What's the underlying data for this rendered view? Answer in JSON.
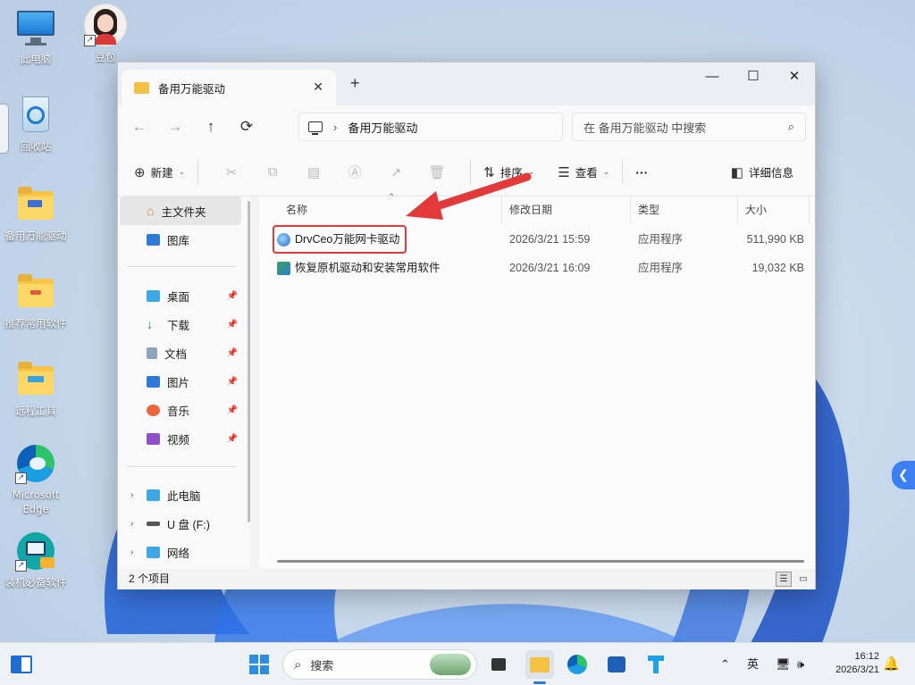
{
  "desktop": {
    "icons": [
      {
        "label": "此电脑"
      },
      {
        "label": "豆包"
      },
      {
        "label": "回收站"
      },
      {
        "label": "备用万能驱动"
      },
      {
        "label": "推荐常用软件"
      },
      {
        "label": "远程工具"
      },
      {
        "label": "Microsoft Edge"
      },
      {
        "label": "装机必备软件"
      }
    ]
  },
  "explorer": {
    "tab_title": "备用万能驱动",
    "tab_close": "✕",
    "new_tab": "+",
    "window_controls": {
      "minimize": "—",
      "maximize": "☐",
      "close": "✕"
    },
    "nav": {
      "back": "←",
      "forward": "→",
      "up": "↑",
      "refresh": "⟳"
    },
    "address": {
      "separator": "›",
      "folder": "备用万能驱动"
    },
    "search": {
      "placeholder": "在 备用万能驱动 中搜索"
    },
    "command_bar": {
      "new_label": "新建",
      "sort_label": "排序",
      "view_label": "查看",
      "more_label": "···",
      "details_label": "详细信息"
    },
    "nav_pane": {
      "home": "主文件夹",
      "gallery": "图库",
      "desktop": "桌面",
      "downloads": "下载",
      "documents": "文档",
      "pictures": "图片",
      "music": "音乐",
      "videos": "视频",
      "this_pc": "此电脑",
      "usb": "U 盘 (F:)",
      "network": "网络"
    },
    "columns": {
      "name": "名称",
      "modified": "修改日期",
      "type": "类型",
      "size": "大小"
    },
    "files": [
      {
        "name": "DrvCeo万能网卡驱动",
        "modified": "2026/3/21 15:59",
        "type": "应用程序",
        "size": "511,990 KB"
      },
      {
        "name": "恢复原机驱动和安装常用软件",
        "modified": "2026/3/21 16:09",
        "type": "应用程序",
        "size": "19,032 KB"
      }
    ],
    "status": "2 个项目"
  },
  "taskbar": {
    "search_label": "搜索",
    "ime": "英",
    "time": "16:12",
    "date": "2026/3/21"
  },
  "colors": {
    "highlight": "#e23a3a",
    "accent": "#2f7ad8"
  }
}
